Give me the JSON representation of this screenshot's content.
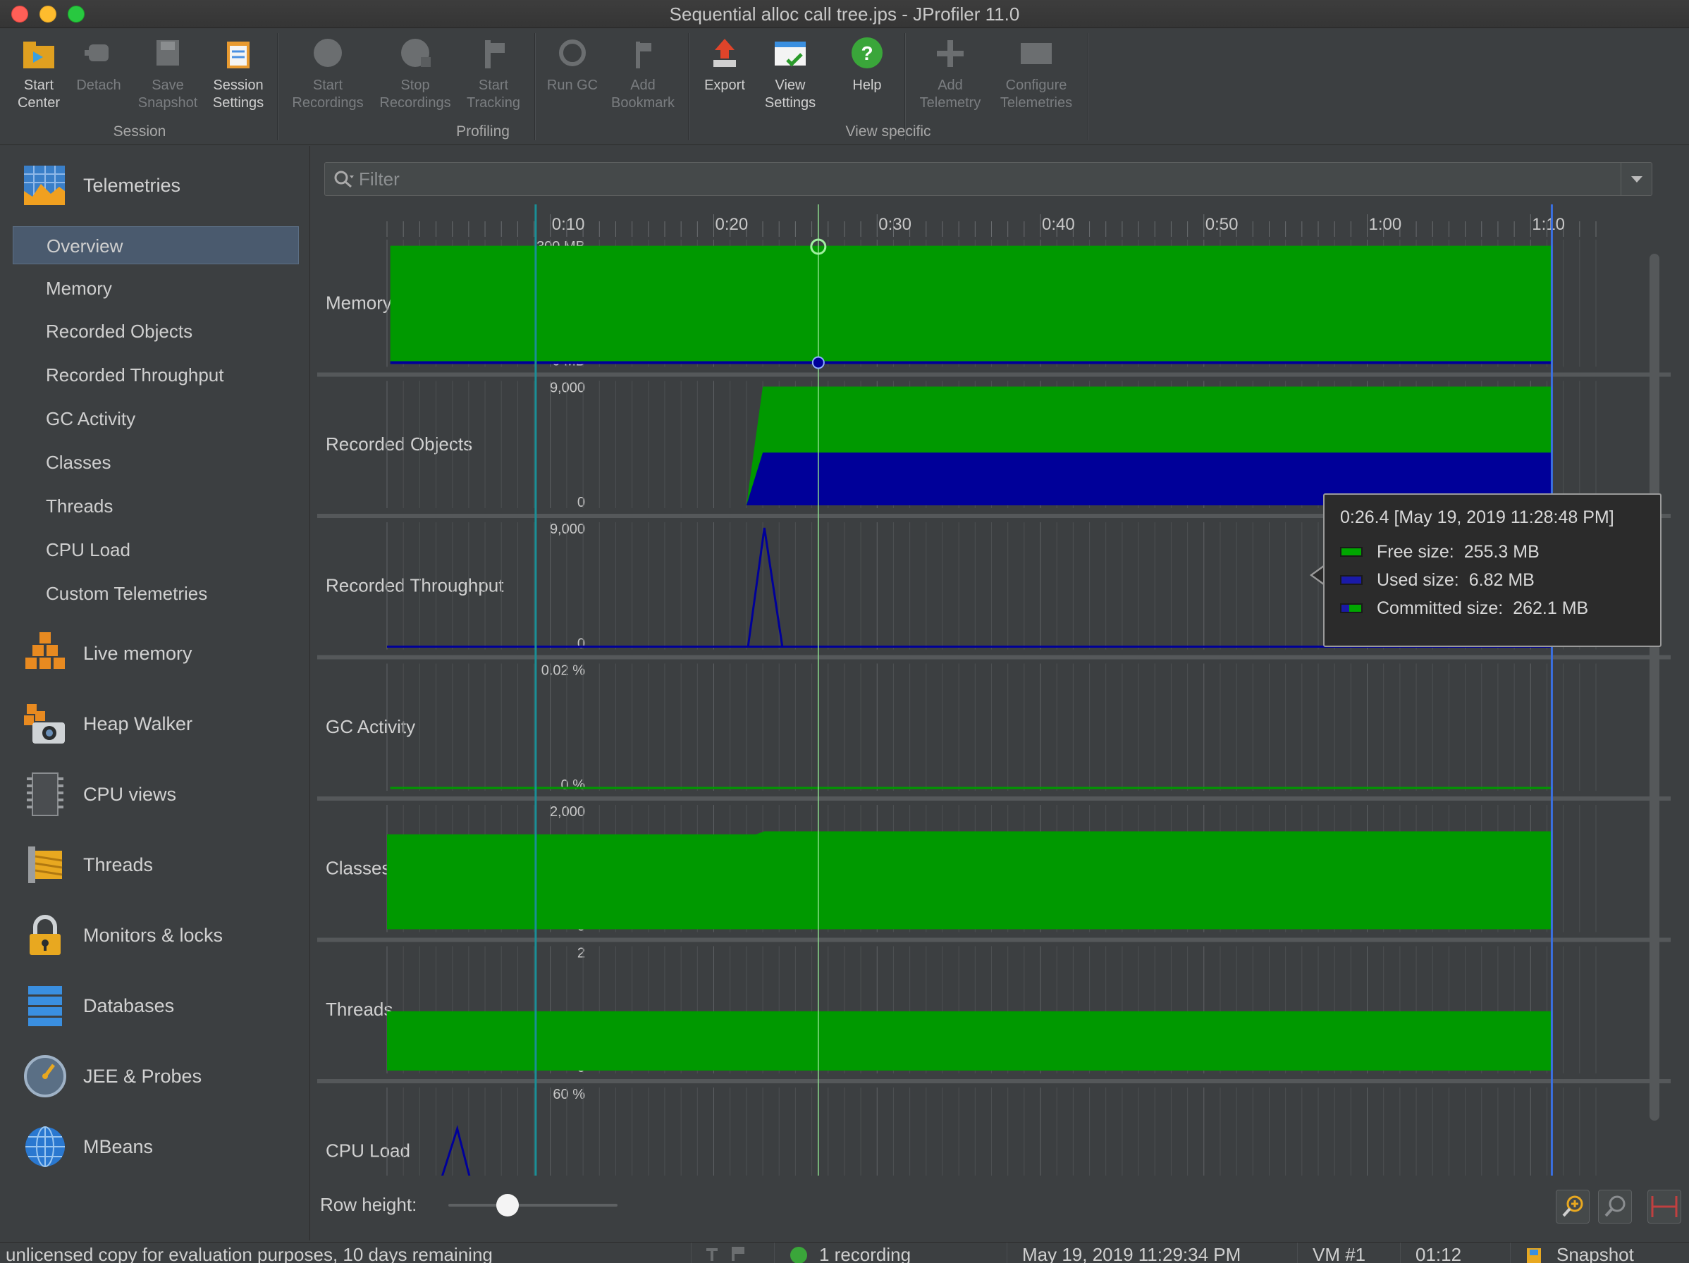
{
  "window": {
    "title": "Sequential alloc call tree.jps - JProfiler 11.0"
  },
  "toolbar": {
    "groups": {
      "session": "Session",
      "profiling": "Profiling",
      "view_specific": "View specific"
    },
    "buttons": {
      "start_center": [
        "Start",
        "Center"
      ],
      "detach": [
        "Detach"
      ],
      "save_snapshot": [
        "Save",
        "Snapshot"
      ],
      "session_settings": [
        "Session",
        "Settings"
      ],
      "start_recordings": [
        "Start",
        "Recordings"
      ],
      "stop_recordings": [
        "Stop",
        "Recordings"
      ],
      "start_tracking": [
        "Start",
        "Tracking"
      ],
      "run_gc": [
        "Run GC"
      ],
      "add_bookmark": [
        "Add",
        "Bookmark"
      ],
      "export": [
        "Export"
      ],
      "view_settings": [
        "View",
        "Settings"
      ],
      "help": [
        "Help"
      ],
      "add_telemetry": [
        "Add",
        "Telemetry"
      ],
      "configure_telemetries": [
        "Configure",
        "Telemetries"
      ]
    }
  },
  "sidebar": {
    "telemetries": "Telemetries",
    "sub_items": [
      "Overview",
      "Memory",
      "Recorded Objects",
      "Recorded Throughput",
      "GC Activity",
      "Classes",
      "Threads",
      "CPU Load",
      "Custom Telemetries"
    ],
    "selected": "Overview",
    "sections": [
      "Live memory",
      "Heap Walker",
      "CPU views",
      "Threads",
      "Monitors & locks",
      "Databases",
      "JEE & Probes",
      "MBeans"
    ]
  },
  "filter": {
    "placeholder": "Filter"
  },
  "chart_data": {
    "type": "area",
    "time_axis_ticks": [
      "0:10",
      "0:20",
      "0:30",
      "0:40",
      "0:50",
      "1:00",
      "1:10"
    ],
    "time_range_seconds": [
      0,
      74
    ],
    "cursor_time": "0:26.4",
    "rows": [
      {
        "label": "Memory",
        "y_max": "300 MB",
        "y_min": "0 MB",
        "series": [
          {
            "name": "Free size",
            "color": "#009900",
            "values": [
              255.3
            ]
          },
          {
            "name": "Used size",
            "color": "#000099",
            "values": [
              6.82
            ]
          }
        ]
      },
      {
        "label": "Recorded Objects",
        "y_max": "9,000",
        "y_min": "0",
        "series": [
          {
            "color": "#009900",
            "points": [
              [
                22,
                0
              ],
              [
                23,
                9000
              ],
              [
                74,
                9000
              ]
            ]
          },
          {
            "color": "#000099",
            "points": [
              [
                22,
                0
              ],
              [
                23,
                4000
              ],
              [
                74,
                4000
              ]
            ]
          }
        ]
      },
      {
        "label": "Recorded Throughput",
        "y_max": "9,000",
        "y_min": "0",
        "series": [
          {
            "color": "#000099",
            "points": [
              [
                0,
                0
              ],
              [
                22.1,
                0
              ],
              [
                23.1,
                9000
              ],
              [
                24.2,
                0
              ],
              [
                74,
                0
              ]
            ]
          }
        ]
      },
      {
        "label": "GC Activity",
        "y_max": "0.02 %",
        "y_min": "0 %",
        "series": []
      },
      {
        "label": "Classes",
        "y_max": "2,000",
        "y_min": "0",
        "series": [
          {
            "color": "#009900",
            "points": [
              [
                0,
                1600
              ],
              [
                22.6,
                1600
              ],
              [
                23.1,
                1650
              ],
              [
                74,
                1650
              ]
            ]
          }
        ]
      },
      {
        "label": "Threads",
        "y_max": "2",
        "y_min": "0",
        "series": [
          {
            "color": "#009900",
            "points": [
              [
                0,
                1
              ],
              [
                74,
                1
              ]
            ]
          }
        ]
      },
      {
        "label": "CPU Load",
        "y_max": "60 %",
        "y_min": "",
        "series": [
          {
            "color": "#000099",
            "points": [
              [
                1.5,
                0
              ],
              [
                2,
                6
              ],
              [
                3.3,
                16
              ],
              [
                4.3,
                42
              ],
              [
                5.3,
                10
              ],
              [
                6.1,
                8
              ],
              [
                6.6,
                0
              ],
              [
                17.3,
                0
              ],
              [
                17.8,
                15
              ],
              [
                18.3,
                0
              ],
              [
                20.4,
                0
              ],
              [
                20.7,
                8
              ],
              [
                21,
                0
              ],
              [
                25,
                0
              ],
              [
                25.3,
                2
              ],
              [
                26.3,
                2
              ],
              [
                26.6,
                0
              ],
              [
                54.6,
                0
              ],
              [
                54.9,
                5
              ],
              [
                55.3,
                0
              ],
              [
                60,
                0
              ],
              [
                60.4,
                4
              ],
              [
                61.3,
                8
              ],
              [
                61.7,
                0
              ]
            ]
          }
        ]
      }
    ]
  },
  "tooltip": {
    "title": "0:26.4 [May 19, 2019 11:28:48 PM]",
    "rows": [
      {
        "key": "Free size:",
        "value": "255.3 MB"
      },
      {
        "key": "Used size:",
        "value": "6.82 MB"
      },
      {
        "key": "Committed size:",
        "value": "262.1 MB"
      }
    ]
  },
  "bottom": {
    "row_height_label": "Row height:",
    "row_height_level": 0.3
  },
  "statusbar": {
    "license": "unlicensed copy for evaluation purposes, 10 days remaining",
    "recording": "1 recording",
    "datetime": "May 19, 2019 11:29:34 PM",
    "vm": "VM #1",
    "elapsed": "01:12",
    "mode": "Snapshot"
  }
}
